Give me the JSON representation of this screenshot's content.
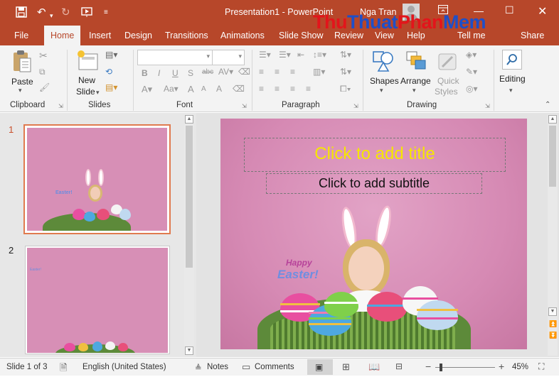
{
  "titlebar": {
    "doc_title": "Presentation1 - PowerPoint",
    "user_name": "Nga Tran"
  },
  "watermark": {
    "part1": "Thu",
    "part2": "Thuat",
    "part3": "Phan",
    "part4": "Mem",
    ".vn": ".vn"
  },
  "tabs": {
    "file": "File",
    "home": "Home",
    "insert": "Insert",
    "design": "Design",
    "transitions": "Transitions",
    "animations": "Animations",
    "slideshow": "Slide Show",
    "review": "Review",
    "view": "View",
    "help": "Help",
    "tellme": "Tell me",
    "share": "Share"
  },
  "ribbon": {
    "paste": "Paste",
    "clipboard": "Clipboard",
    "new_slide_1": "New",
    "new_slide_2": "Slide",
    "slides": "Slides",
    "font": "Font",
    "paragraph": "Paragraph",
    "shapes": "Shapes",
    "arrange": "Arrange",
    "quick_styles_1": "Quick",
    "quick_styles_2": "Styles",
    "drawing": "Drawing",
    "editing": "Editing"
  },
  "thumbs": {
    "n1": "1",
    "n2": "2"
  },
  "slide": {
    "title_placeholder": "Click to add title",
    "subtitle_placeholder": "Click to add subtitle",
    "banner_line1": "Happy",
    "banner_line2": "Easter!"
  },
  "status": {
    "slide_info": "Slide 1 of 3",
    "language": "English (United States)",
    "notes": "Notes",
    "comments": "Comments",
    "zoom": "45%"
  },
  "colors": {
    "accent": "#b7472a",
    "title_text": "#f6e700",
    "slide_bg": "#d68ab4"
  }
}
